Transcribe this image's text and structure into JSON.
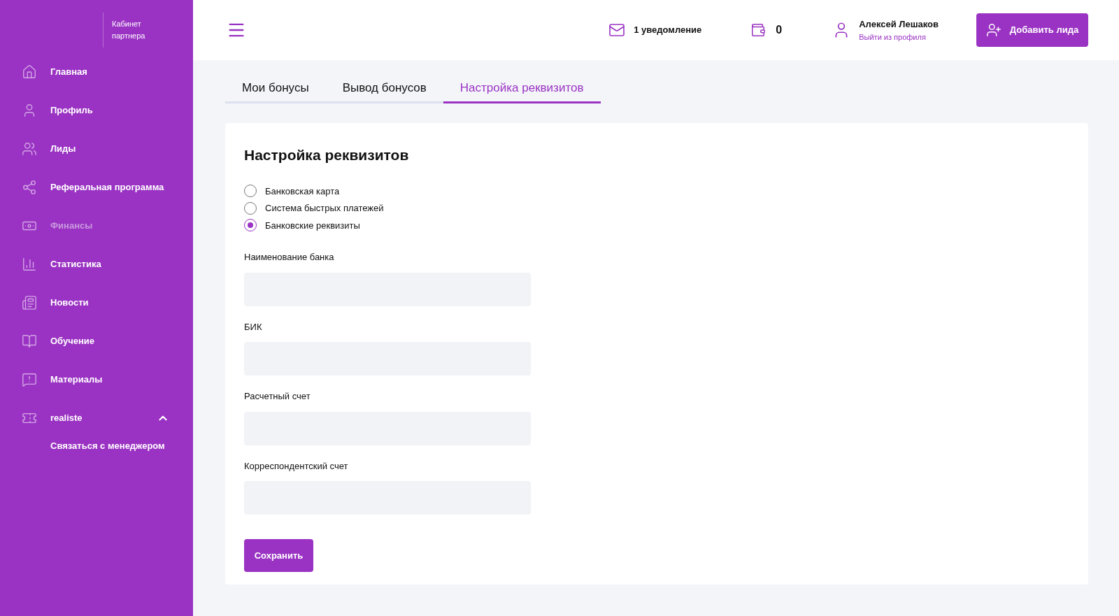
{
  "brand": {
    "subtitle": "Кабинет партнера"
  },
  "sidebar": {
    "items": [
      {
        "kind": "home",
        "label": "Главная",
        "disabled": false
      },
      {
        "kind": "profile",
        "label": "Профиль",
        "disabled": false
      },
      {
        "kind": "leads",
        "label": "Лиды",
        "disabled": false
      },
      {
        "kind": "referral",
        "label": "Реферальная программа",
        "disabled": false
      },
      {
        "kind": "finance",
        "label": "Финансы",
        "disabled": true
      },
      {
        "kind": "stats",
        "label": "Статистика",
        "disabled": false
      },
      {
        "kind": "news",
        "label": "Новости",
        "disabled": false
      },
      {
        "kind": "learn",
        "label": "Обучение",
        "disabled": false
      },
      {
        "kind": "materials",
        "label": "Материалы",
        "disabled": false
      },
      {
        "kind": "ticket",
        "label": "realiste",
        "disabled": false,
        "expanded": true,
        "children": [
          {
            "label": "Связаться с менеджером"
          }
        ]
      }
    ]
  },
  "header": {
    "notifications": "1 уведомление",
    "wallet": "0",
    "user": {
      "name": "Алексей Лешаков",
      "logout": "Выйти из профиля"
    },
    "add_button": "Добавить лида"
  },
  "tabs": [
    {
      "label": "Мои бонусы",
      "selected": false
    },
    {
      "label": "Вывод бонусов",
      "selected": false
    },
    {
      "label": "Настройка реквизитов",
      "selected": true
    }
  ],
  "card": {
    "title": "Настройка реквизитов",
    "options": [
      {
        "label": "Банковская карта",
        "selected": false
      },
      {
        "label": "Система быстрых платежей",
        "selected": false
      },
      {
        "label": "Банковские реквизиты",
        "selected": true
      }
    ],
    "fields": [
      {
        "label": "Наименование банка"
      },
      {
        "label": "БИК"
      },
      {
        "label": "Расчетный счет"
      },
      {
        "label": "Корреспондентский счет"
      }
    ],
    "save_button": "Сохранить"
  }
}
